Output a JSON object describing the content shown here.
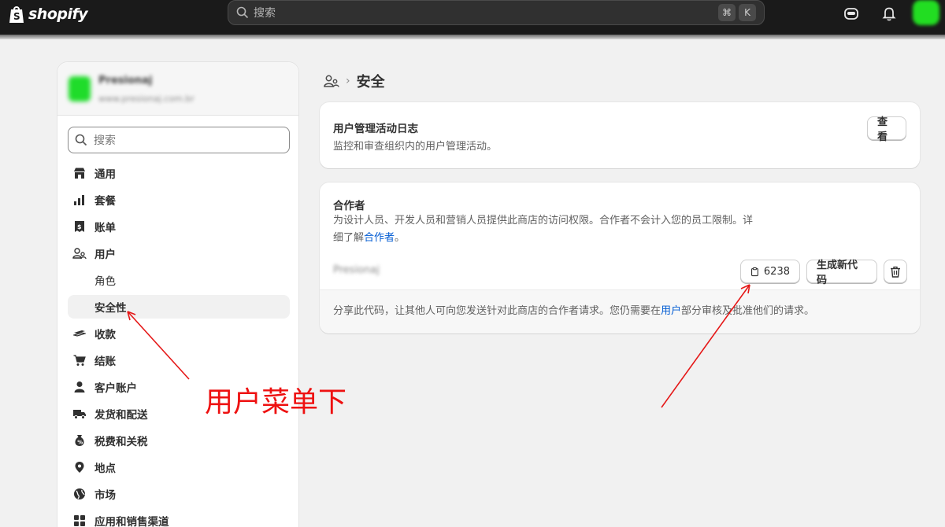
{
  "topbar": {
    "brand": "shopify",
    "search_placeholder": "搜索",
    "shortcut_keys": [
      "⌘",
      "K"
    ]
  },
  "sidebar": {
    "store_name": "Presionaj",
    "store_url": "www.presionaj.com.br",
    "search_placeholder": "搜索",
    "items": [
      {
        "label": "通用",
        "icon": "store-icon"
      },
      {
        "label": "套餐",
        "icon": "plan-chart-icon"
      },
      {
        "label": "账单",
        "icon": "billing-icon"
      },
      {
        "label": "用户",
        "icon": "users-icon"
      },
      {
        "label": "角色",
        "icon": ""
      },
      {
        "label": "安全性",
        "icon": ""
      },
      {
        "label": "收款",
        "icon": "payments-icon"
      },
      {
        "label": "结账",
        "icon": "cart-icon"
      },
      {
        "label": "客户账户",
        "icon": "person-icon"
      },
      {
        "label": "发货和配送",
        "icon": "truck-icon"
      },
      {
        "label": "税费和关税",
        "icon": "tax-bag-icon"
      },
      {
        "label": "地点",
        "icon": "location-pin-icon"
      },
      {
        "label": "市场",
        "icon": "globe-icon"
      },
      {
        "label": "应用和销售渠道",
        "icon": "apps-icon"
      }
    ]
  },
  "main": {
    "page_title": "安全",
    "activity_log": {
      "title": "用户管理活动日志",
      "description": "监控和审查组织内的用户管理活动。",
      "view_button": "查看"
    },
    "collaborators": {
      "title": "合作者",
      "description_line1": "为设计人员、开发人员和营销人员提供此商店的访问权限。合作者不会计入您的员工限制。详",
      "description_line2_prefix": "细了解",
      "description_link": "合作者",
      "description_line2_suffix": "。",
      "partner_name": "Presionaj",
      "code": "6238",
      "generate_button": "生成新代码",
      "footer_prefix": "分享此代码，让其他人可向您发送针对此商店的合作者请求。您仍需要在",
      "footer_link": "用户",
      "footer_suffix": "部分审核及批准他们的请求。"
    }
  },
  "annotation": {
    "text": "用户菜单下",
    "color": "#ee1111"
  }
}
